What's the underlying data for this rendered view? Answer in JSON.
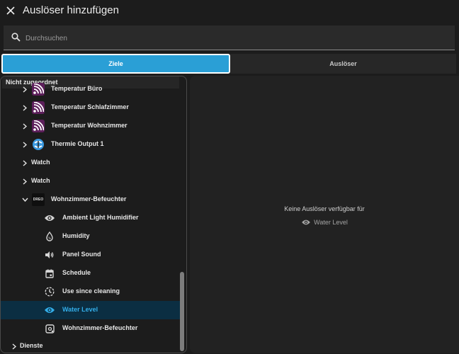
{
  "dialog": {
    "title": "Auslöser hinzufügen"
  },
  "search": {
    "placeholder": "Durchsuchen",
    "value": ""
  },
  "tabs": [
    {
      "label": "Ziele",
      "active": true
    },
    {
      "label": "Auslöser",
      "active": false
    }
  ],
  "tree": {
    "group_label": "Nicht zugeordnet",
    "items": [
      {
        "label": "Temperatur Büro",
        "icon": "wifi-tile-icon",
        "expandable": true
      },
      {
        "label": "Temperatur Schlafzimmer",
        "icon": "wifi-tile-icon",
        "expandable": true
      },
      {
        "label": "Temperatur Wohnzimmer",
        "icon": "wifi-tile-icon",
        "expandable": true
      },
      {
        "label": "Thermie Output 1",
        "icon": "integration-logo-icon",
        "expandable": true
      },
      {
        "label": "Watch",
        "icon": "",
        "expandable": true
      },
      {
        "label": "Watch",
        "icon": "",
        "expandable": true
      },
      {
        "label": "Wohnzimmer-Befeuchter",
        "icon": "device-tile-icon",
        "expanded": true,
        "tile_text": "DREO"
      }
    ],
    "entities": [
      {
        "label": "Ambient Light Humidifier",
        "icon": "eye-icon"
      },
      {
        "label": "Humidity",
        "icon": "water-drop-icon"
      },
      {
        "label": "Panel Sound",
        "icon": "speaker-icon"
      },
      {
        "label": "Schedule",
        "icon": "calendar-icon"
      },
      {
        "label": "Use since cleaning",
        "icon": "history-icon"
      },
      {
        "label": "Water Level",
        "icon": "eye-icon",
        "selected": true
      },
      {
        "label": "Wohnzimmer-Befeuchter",
        "icon": "device-icon"
      }
    ],
    "footer_item": {
      "label": "Dienste",
      "expandable": true
    }
  },
  "empty_state": {
    "message": "Keine Auslöser verfügbar für",
    "entity": "Water Level",
    "entity_icon": "eye-icon"
  },
  "colors": {
    "accent": "#2a9fd6",
    "selected_text": "#33aee9",
    "selected_bg": "#0b2e42",
    "background": "#1c1c1c"
  }
}
